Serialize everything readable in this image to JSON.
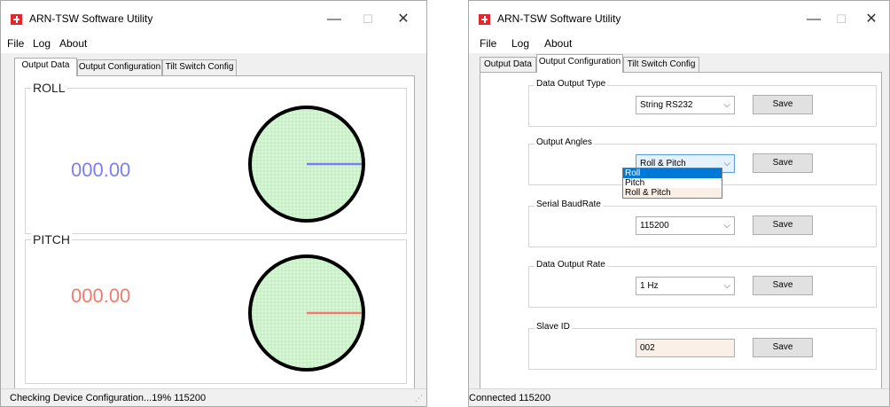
{
  "left_window": {
    "title": "ARN-TSW Software Utility",
    "menu": {
      "file": "File",
      "log": "Log",
      "about": "About"
    },
    "tabs": [
      "Output Data",
      "Output Configuration",
      "Tilt Switch Config"
    ],
    "roll": {
      "label": "ROLL",
      "value": "000.00",
      "color": "#7b7ff0",
      "angle_deg": 0
    },
    "pitch": {
      "label": "PITCH",
      "value": "000.00",
      "color": "#f07b6e",
      "angle_deg": 0
    },
    "gauge_colors": {
      "face": "#d9f6d8",
      "grid": "#b4e8b3",
      "rim": "#000000"
    },
    "status": "Checking Device Configuration...19%  115200"
  },
  "right_window": {
    "title": "ARN-TSW Software Utility",
    "menu": {
      "file": "File",
      "log": "Log",
      "about": "About"
    },
    "tabs": [
      "Output Data",
      "Output Configuration",
      "Tilt Switch Config"
    ],
    "save_label": "Save",
    "data_output_type": {
      "label": "Data Output Type",
      "value": "String RS232"
    },
    "output_angles": {
      "label": "Output Angles",
      "value": "Roll & Pitch",
      "options": [
        "Roll",
        "Pitch",
        "Roll & Pitch"
      ]
    },
    "serial_baudrate": {
      "label": "Serial BaudRate",
      "value": "115200"
    },
    "data_output_rate": {
      "label": "Data Output Rate",
      "value": "1 Hz"
    },
    "slave_id": {
      "label": "Slave ID",
      "value": "002"
    },
    "status": "Connected  115200"
  },
  "window_controls": {
    "minimize": "—",
    "maximize": "☐",
    "close": "✕"
  },
  "dropdown_arrow": "⌵",
  "resize_grip": "⋰"
}
